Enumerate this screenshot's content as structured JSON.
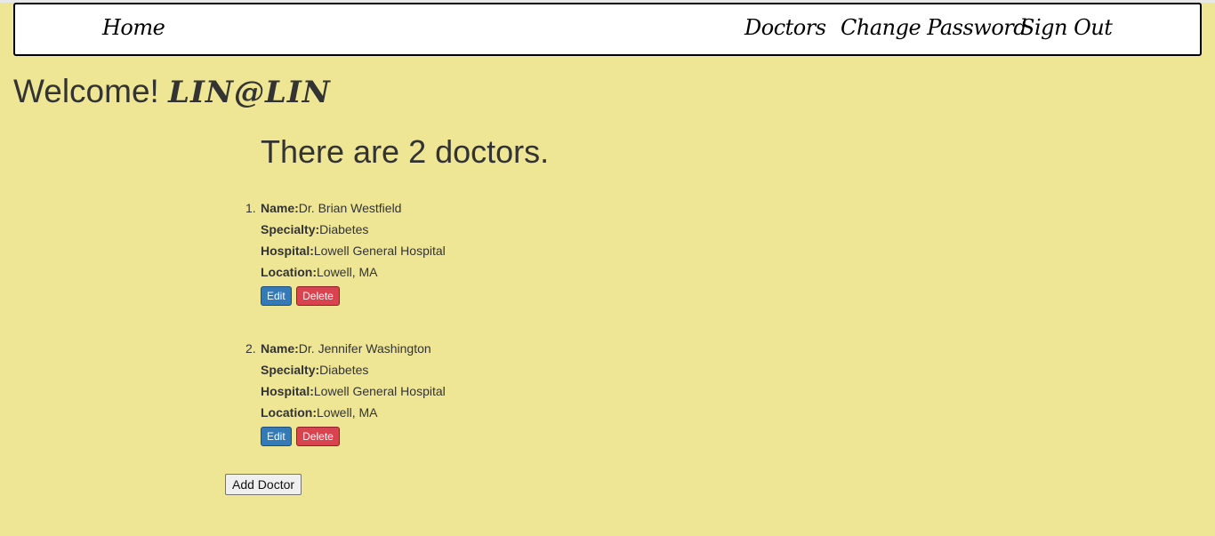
{
  "nav": {
    "home": "Home",
    "doctors": "Doctors",
    "change_password": "Change Password",
    "sign_out": "Sign Out"
  },
  "welcome": {
    "prefix": "Welcome!",
    "username": "LIN@LIN"
  },
  "count_heading": "There are 2 doctors.",
  "labels": {
    "name": "Name:",
    "specialty": "Specialty:",
    "hospital": "Hospital:",
    "location": "Location:",
    "edit": "Edit",
    "delete": "Delete"
  },
  "doctors": [
    {
      "number": "1.",
      "name": "Dr. Brian Westfield",
      "specialty": "Diabetes",
      "hospital": "Lowell General Hospital",
      "location": "Lowell, MA"
    },
    {
      "number": "2.",
      "name": "Dr. Jennifer Washington",
      "specialty": "Diabetes",
      "hospital": "Lowell General Hospital",
      "location": "Lowell, MA"
    }
  ],
  "add_button": "Add Doctor",
  "colors": {
    "background": "#eee695",
    "edit": "#337ab7",
    "delete": "#d9434f"
  }
}
